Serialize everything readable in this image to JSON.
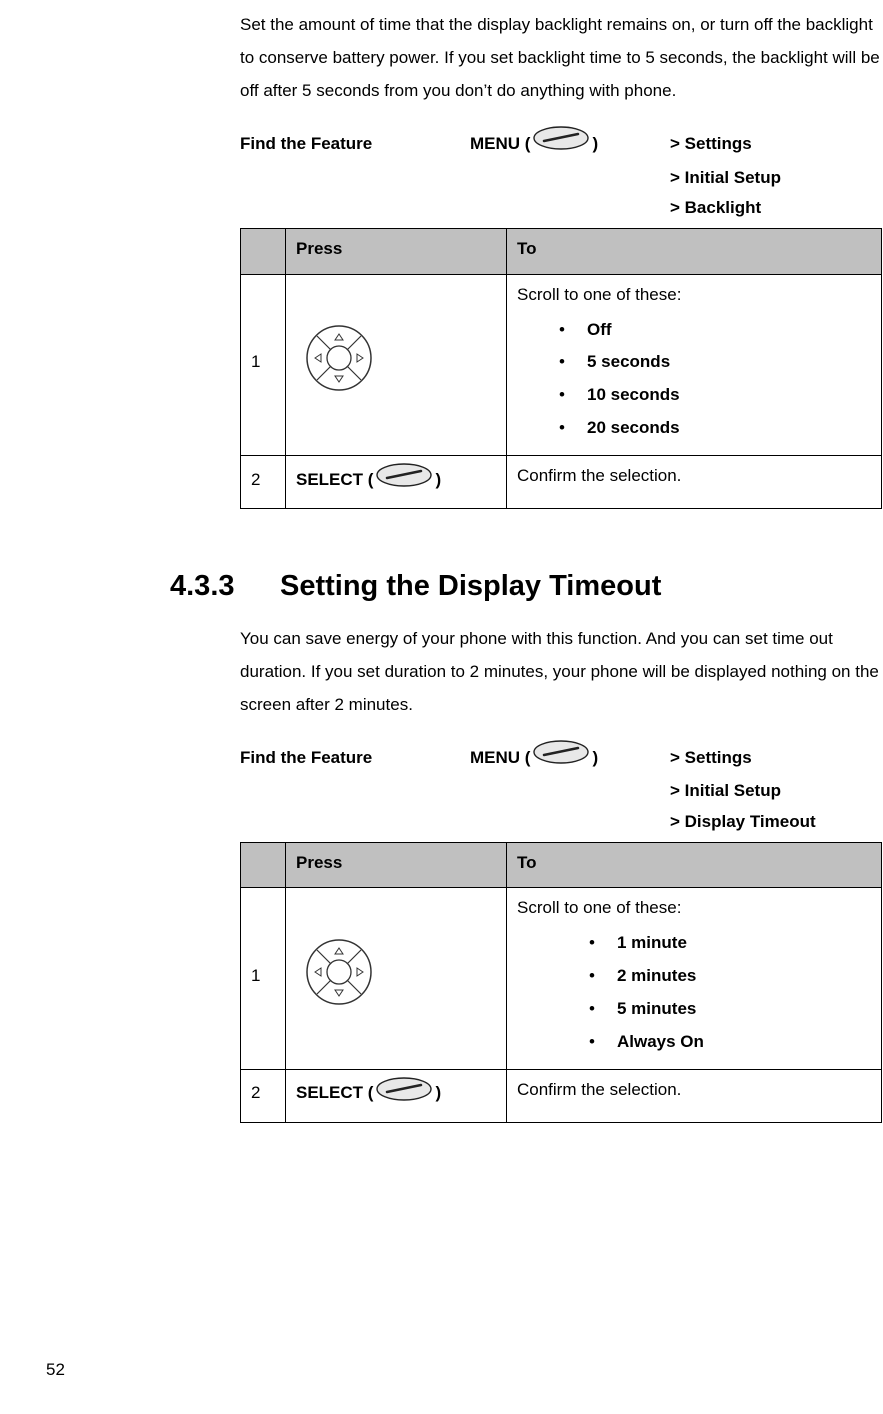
{
  "page_number": "52",
  "section1": {
    "intro": "Set the amount of time that the display backlight remains on, or turn off the backlight to conserve battery power. If you set backlight time to 5 seconds, the backlight will be off after 5 seconds from you don’t do anything with phone.",
    "find_feature": "Find the Feature",
    "menu_label_pre": "MENU (",
    "menu_label_post": ")",
    "crumb1": "> Settings",
    "crumb2": "> Initial Setup",
    "crumb3": "> Backlight",
    "table": {
      "h1": "",
      "h2": "Press",
      "h3": "To",
      "r1_num": "1",
      "r1_lead": "Scroll to one of these:",
      "r1_opt1": "Off",
      "r1_opt2": "5 seconds",
      "r1_opt3": "10 seconds",
      "r1_opt4": "20 seconds",
      "r2_num": "2",
      "r2_press_pre": "SELECT (",
      "r2_press_post": ")",
      "r2_to": "Confirm the selection."
    }
  },
  "section2": {
    "number": "4.3.3",
    "title": "Setting the Display Timeout",
    "intro": "You can save energy of your phone with this function. And you can set time out duration. If you set duration to 2 minutes, your phone will be displayed nothing on the screen after 2 minutes.",
    "find_feature": "Find the Feature",
    "menu_label_pre": "MENU (",
    "menu_label_post": ")",
    "crumb1": "> Settings",
    "crumb2": "> Initial Setup",
    "crumb3": "> Display Timeout",
    "table": {
      "h1": "",
      "h2": "Press",
      "h3": "To",
      "r1_num": "1",
      "r1_lead": "Scroll to one of these:",
      "r1_opt1": "1 minute",
      "r1_opt2": "2 minutes",
      "r1_opt3": "5 minutes",
      "r1_opt4": "Always On",
      "r2_num": "2",
      "r2_press_pre": "SELECT (",
      "r2_press_post": ")",
      "r2_to": "Confirm the selection."
    }
  }
}
